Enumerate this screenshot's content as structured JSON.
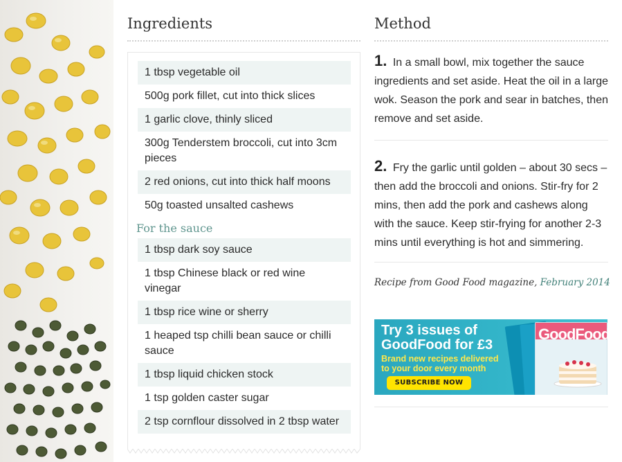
{
  "ingredients": {
    "heading": "Ingredients",
    "items": [
      "1 tbsp vegetable oil",
      "500g pork fillet, cut into thick slices",
      "1 garlic clove, thinly sliced",
      "300g Tenderstem broccoli, cut into 3cm pieces",
      "2 red onions, cut into thick half moons",
      "50g toasted unsalted cashews"
    ],
    "sauce_heading": "For the sauce",
    "sauce_items": [
      "1 tbsp dark soy sauce",
      "1 tbsp Chinese black or red wine vinegar",
      "1 tbsp rice wine or sherry",
      "1 heaped tsp chilli bean sauce or chilli sauce",
      "1 tbsp liquid chicken stock",
      "1 tsp golden caster sugar",
      "2 tsp cornflour dissolved in 2 tbsp water"
    ]
  },
  "method": {
    "heading": "Method",
    "steps": [
      {
        "number": "1.",
        "text": "In a small bowl, mix together the sauce ingredients and set aside. Heat the oil in a large wok. Season the pork and sear in batches, then remove and set aside."
      },
      {
        "number": "2.",
        "text": "Fry the garlic until golden – about 30 secs – then add the broccoli and onions. Stir-fry for 2 mins, then add the pork and cashews along with the sauce. Keep stir-frying for another 2-3 mins until everything is hot and simmering."
      }
    ],
    "source_prefix": "Recipe from Good Food magazine,",
    "source_link": "February 2014"
  },
  "ad": {
    "title_line1": "Try 3 issues of",
    "title_line2": "GoodFood for £3",
    "sub_line1": "Brand new recipes delivered",
    "sub_line2": "to your door every month",
    "button": "SUBSCRIBE NOW",
    "magazine_logo": "GoodFood",
    "colors": {
      "background": "#33b5c9",
      "highlight": "#ffe84a",
      "button": "#ffe400"
    }
  }
}
